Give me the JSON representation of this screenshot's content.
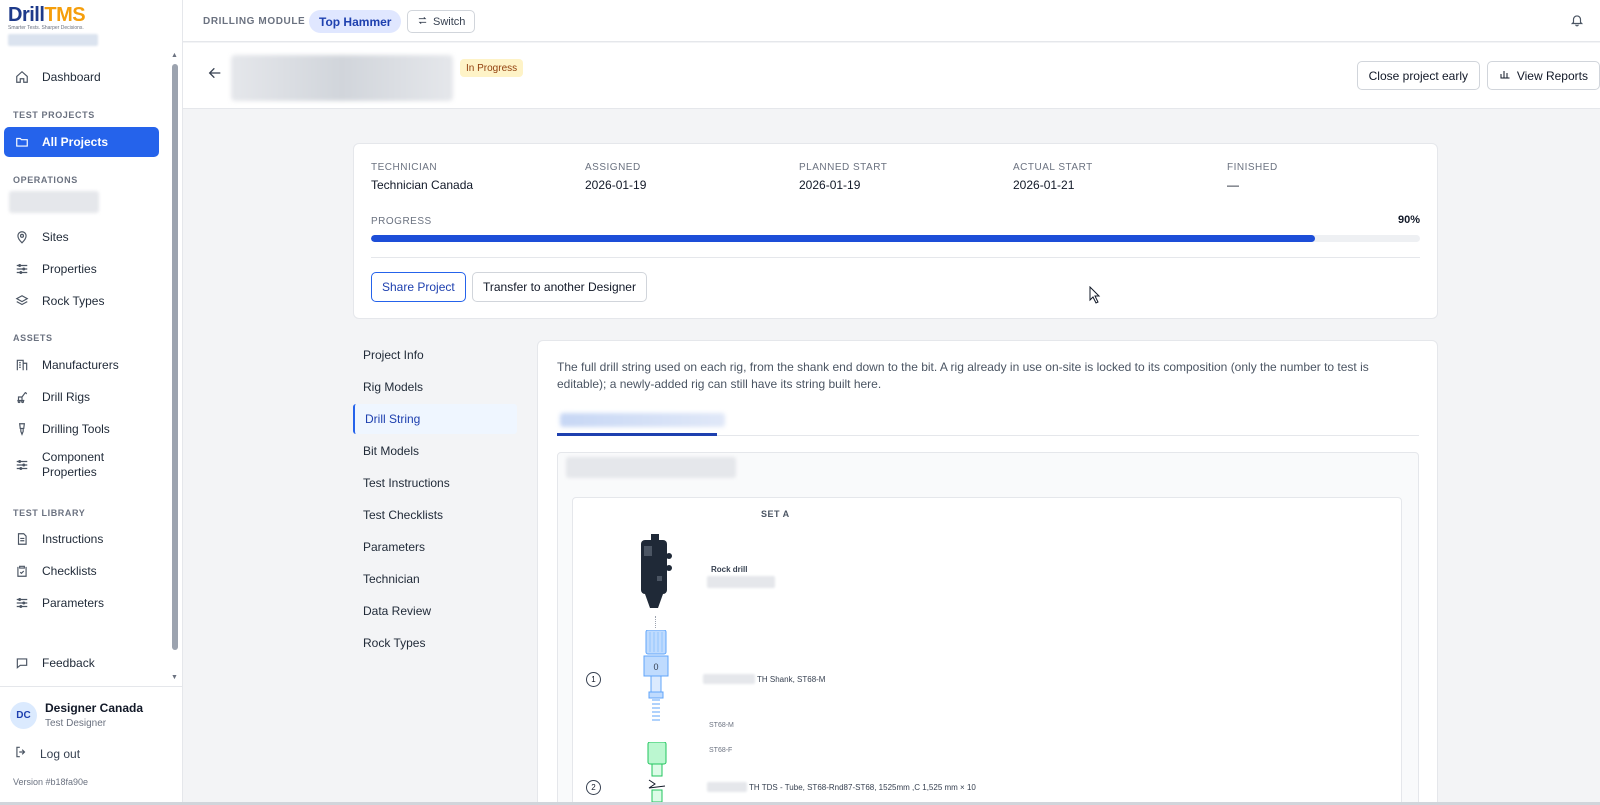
{
  "app": {
    "brand_a": "Drill",
    "brand_b": "TMS",
    "tagline": "Smarter Tests. Sharper Decisions."
  },
  "sidebar": {
    "dashboard": "Dashboard",
    "sections": {
      "test_projects": "TEST PROJECTS",
      "operations": "OPERATIONS",
      "assets": "ASSETS",
      "test_library": "TEST LIBRARY"
    },
    "all_projects": "All Projects",
    "sites": "Sites",
    "properties": "Properties",
    "rock_types": "Rock Types",
    "manufacturers": "Manufacturers",
    "drill_rigs": "Drill Rigs",
    "drilling_tools": "Drilling Tools",
    "component_properties": "Component Properties",
    "instructions": "Instructions",
    "checklists": "Checklists",
    "parameters": "Parameters",
    "feedback": "Feedback"
  },
  "user": {
    "initials": "DC",
    "name": "Designer Canada",
    "role": "Test Designer",
    "logout": "Log out",
    "version": "Version #b18fa90e"
  },
  "topbar": {
    "module_label": "DRILLING MODULE",
    "module": "Top Hammer",
    "switch": "Switch"
  },
  "header": {
    "status": "In Progress",
    "close_early": "Close project early",
    "view_reports": "View Reports"
  },
  "summary": {
    "technician_label": "TECHNICIAN",
    "technician": "Technician Canada",
    "assigned_label": "ASSIGNED",
    "assigned": "2026-01-19",
    "planned_label": "PLANNED START",
    "planned": "2026-01-19",
    "actual_label": "ACTUAL START",
    "actual": "2026-01-21",
    "finished_label": "FINISHED",
    "finished": "—",
    "progress_label": "PROGRESS",
    "progress_text": "90%",
    "progress": 0.9,
    "share": "Share Project",
    "transfer": "Transfer to another Designer"
  },
  "subnav": [
    "Project Info",
    "Rig Models",
    "Drill String",
    "Bit Models",
    "Test Instructions",
    "Test Checklists",
    "Parameters",
    "Technician",
    "Data Review",
    "Rock Types"
  ],
  "content": {
    "description": "The full drill string used on each rig, from the shank end down to the bit. A rig already in use on-site is locked to its composition (only the number to test is editable); a newly-added rig can still have its string built here.",
    "set_label": "SET A",
    "rock_drill": "Rock drill",
    "c1_num": "1",
    "c1_label": "TH Shank, ST68-M",
    "male": "ST68-M",
    "female": "ST68-F",
    "c2_num": "2",
    "c2_label": "TH TDS - Tube, ST68-Rnd87-ST68, 1525mm ,C 1,525 mm × 10"
  }
}
